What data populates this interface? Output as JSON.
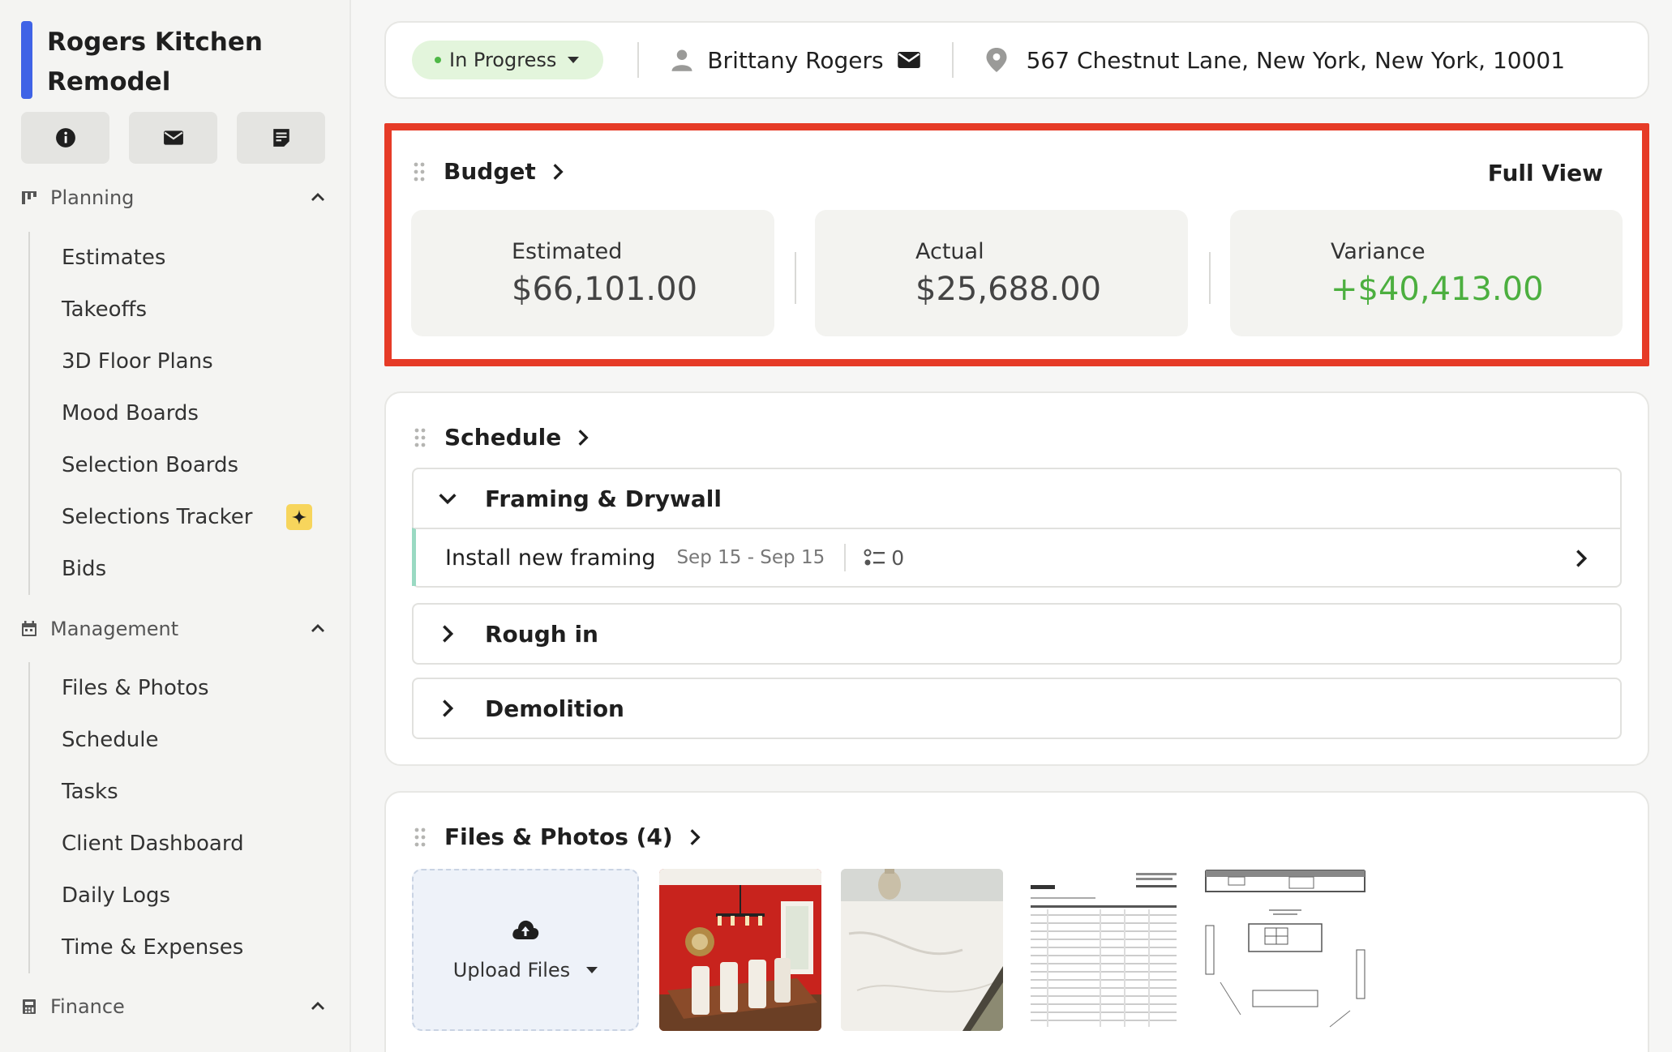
{
  "project": {
    "title": "Rogers Kitchen Remodel",
    "accent": "#3f63e6"
  },
  "quick_actions": [
    {
      "icon": "info-icon"
    },
    {
      "icon": "mail-icon"
    },
    {
      "icon": "note-icon"
    }
  ],
  "sidebar": {
    "planning": {
      "label": "Planning",
      "items": [
        "Estimates",
        "Takeoffs",
        "3D Floor Plans",
        "Mood Boards",
        "Selection Boards",
        "Selections Tracker",
        "Bids"
      ]
    },
    "management": {
      "label": "Management",
      "items": [
        "Files & Photos",
        "Schedule",
        "Tasks",
        "Client Dashboard",
        "Daily Logs",
        "Time & Expenses"
      ]
    },
    "finance": {
      "label": "Finance"
    }
  },
  "header": {
    "status": "In Progress",
    "status_color": "#4fb847",
    "client_name": "Brittany Rogers",
    "address": "567 Chestnut Lane, New York, New York, 10001"
  },
  "budget": {
    "title": "Budget",
    "full_view": "Full View",
    "estimated_label": "Estimated",
    "estimated_value": "$66,101.00",
    "actual_label": "Actual",
    "actual_value": "$25,688.00",
    "variance_label": "Variance",
    "variance_value": "+$40,413.00",
    "highlight_color": "#e63b27"
  },
  "schedule": {
    "title": "Schedule",
    "phases": [
      {
        "name": "Framing & Drywall",
        "expanded": true,
        "tasks": [
          {
            "name": "Install new framing",
            "dates": "Sep 15 - Sep 15",
            "subtasks": "0"
          }
        ]
      },
      {
        "name": "Rough in",
        "expanded": false
      },
      {
        "name": "Demolition",
        "expanded": false
      }
    ]
  },
  "files": {
    "title": "Files & Photos (4)",
    "upload_label": "Upload Files"
  }
}
